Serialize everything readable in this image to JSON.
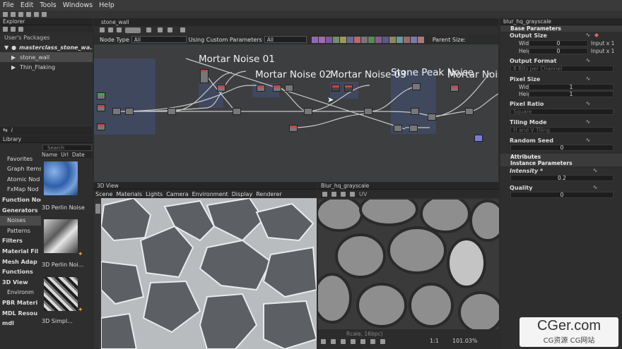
{
  "menu": [
    "File",
    "Edit",
    "Tools",
    "Windows",
    "Help"
  ],
  "explorer": {
    "title": "Explorer",
    "section": "User's Packages",
    "package": "masterclass_stone_wa...",
    "items": [
      "stone_wall",
      "Thin_Flaking"
    ]
  },
  "library": {
    "title": "Library",
    "search_placeholder": "Search",
    "columns": [
      "Name",
      "Url",
      "Date"
    ],
    "categories": [
      {
        "label": "Favorites",
        "bold": false
      },
      {
        "label": "Graph Items",
        "bold": false
      },
      {
        "label": "Atomic Nod",
        "bold": false
      },
      {
        "label": "FxMap Nod",
        "bold": false
      },
      {
        "label": "Function Nod",
        "bold": true
      },
      {
        "label": "Generators",
        "bold": true
      },
      {
        "label": "Noises",
        "bold": false
      },
      {
        "label": "Patterns",
        "bold": false
      },
      {
        "label": "Filters",
        "bold": true
      },
      {
        "label": "Material Fil",
        "bold": true
      },
      {
        "label": "Mesh Adap",
        "bold": true
      },
      {
        "label": "Functions",
        "bold": true
      },
      {
        "label": "3D View",
        "bold": true
      },
      {
        "label": "Environm",
        "bold": false
      },
      {
        "label": "PBR Materi",
        "bold": true
      },
      {
        "label": "MDL Resou",
        "bold": true
      },
      {
        "label": "mdl",
        "bold": true
      }
    ],
    "thumbnails": [
      "3D Perlin Noise",
      "3D Perlin Noi...",
      "3D Simpl..."
    ]
  },
  "graph": {
    "tab": "stone_wall",
    "node_type_label": "Node Type",
    "node_type_value": "All",
    "custom_params_label": "Using Custom Parameters",
    "custom_params_value": "All",
    "parent_size_label": "Parent Size:",
    "frames": [
      "Mortar Noise 01",
      "Mortar Noise 02",
      "Mortar Noise 03",
      "Stone Peak Noise",
      "Mortar Noise"
    ]
  },
  "view3d": {
    "title": "3D View",
    "menu": [
      "Scene",
      "Materials",
      "Lights",
      "Camera",
      "Environment",
      "Display",
      "Renderer"
    ]
  },
  "view2d": {
    "title": "Blur_hq_grayscale",
    "toolbar_label": "UV",
    "status": "Rcale, 16bpc)",
    "zoom_ratio": "1:1",
    "zoom": "101.03%"
  },
  "props": {
    "title": "blur_hq_grayscale",
    "base_params": "Base Parameters",
    "output_size": "Output Size",
    "width_label": "Width",
    "width_value": "0",
    "width_mult": "Input x 1",
    "height_label": "Height",
    "height_value": "0",
    "height_mult": "Input x 1",
    "output_format": "Output Format",
    "output_format_value": "8 Bits per Channel",
    "pixel_size": "Pixel Size",
    "px_width_value": "1",
    "px_height_value": "1",
    "pixel_ratio": "Pixel Ratio",
    "pixel_ratio_value": "Square",
    "tiling_mode": "Tiling Mode",
    "tiling_value": "H and V Tiling",
    "random_seed": "Random Seed",
    "random_seed_value": "0",
    "attributes": "Attributes",
    "instance_params": "Instance Parameters",
    "intensity_label": "Intensity *",
    "intensity_value": "0.2",
    "quality_label": "Quality",
    "quality_value": "0"
  },
  "watermark": {
    "line1": "CGer.com",
    "line2": "CG资源 CG网站"
  },
  "colors": {
    "frame": "#3f4a63",
    "accent_red": "#c44444",
    "panel": "#2e2e2e"
  }
}
